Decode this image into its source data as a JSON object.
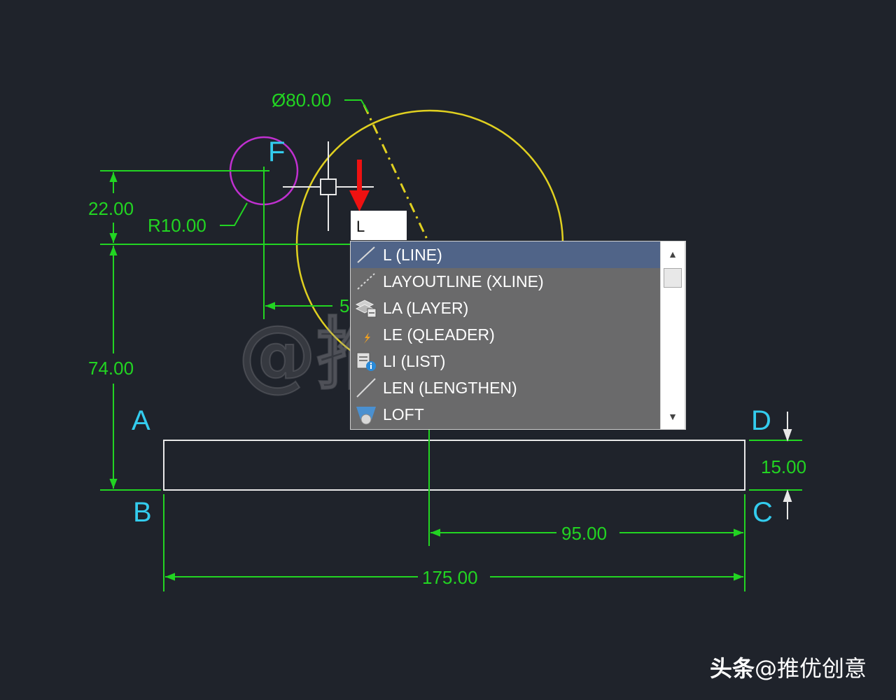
{
  "drawing": {
    "dimensions": {
      "diameter": "Ø80.00",
      "radius": "R10.00",
      "d22": "22.00",
      "d74": "74.00",
      "d15": "15.00",
      "d95": "95.00",
      "d175": "175.00",
      "hidden_partial": "5"
    },
    "points": {
      "a": "A",
      "b": "B",
      "c": "C",
      "d": "D",
      "f": "F"
    },
    "colors": {
      "dimension": "#22d422",
      "big_circle": "#e0d020",
      "small_circle": "#c030d0",
      "labels": "#33ccee",
      "rectangle": "#e8e8e8",
      "arrow": "#ee1111"
    }
  },
  "command_input": {
    "value": "L"
  },
  "autocomplete": {
    "items": [
      {
        "label": "L (LINE)",
        "icon": "line-icon",
        "selected": true
      },
      {
        "label": "LAYOUTLINE (XLINE)",
        "icon": "xline-icon",
        "selected": false
      },
      {
        "label": "LA (LAYER)",
        "icon": "layer-icon",
        "selected": false
      },
      {
        "label": "LE (QLEADER)",
        "icon": "qleader-icon",
        "selected": false
      },
      {
        "label": "LI (LIST)",
        "icon": "list-icon",
        "selected": false
      },
      {
        "label": "LEN (LENGTHEN)",
        "icon": "lengthen-icon",
        "selected": false
      },
      {
        "label": "LOFT",
        "icon": "loft-icon",
        "selected": false
      }
    ],
    "scroll_up": "▲",
    "scroll_down": "▼"
  },
  "watermark": "@推优创意",
  "brand": {
    "name": "头条",
    "handle": "@推优创意"
  }
}
